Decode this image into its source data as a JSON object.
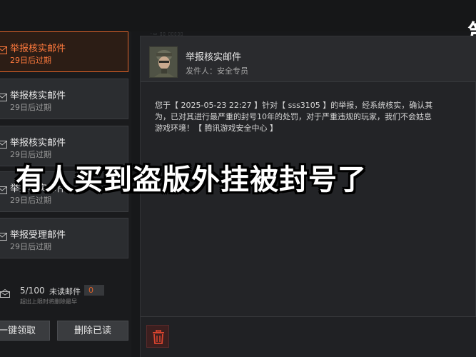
{
  "mail_list": [
    {
      "title": "举报核实邮件",
      "expire": "29日后过期",
      "active": true
    },
    {
      "title": "举报核实邮件",
      "expire": "29日后过期",
      "active": false
    },
    {
      "title": "举报核实邮件",
      "expire": "29日后过期",
      "active": false
    },
    {
      "title": "举报核实邮件",
      "expire": "29日后过期",
      "active": false
    },
    {
      "title": "举报受理邮件",
      "expire": "29日后过期",
      "active": false
    }
  ],
  "mailbox": {
    "count": "5/100",
    "unread_label": "未读邮件",
    "unread_count": "0",
    "limit_note": "超出上限时将删除最早"
  },
  "buttons": {
    "claim": "一键领取",
    "delete_read": "删除已读"
  },
  "detail": {
    "title": "举报核实邮件",
    "sender": "发件人：安全专员",
    "body_lines": [
      "您于【 2025-05-23 22:27 】针对【 sss3105 】的举报，经系统核实，确认其",
      "为，已对其进行最严重的封号10年的处罚，对于严重违规的玩家，我们不会姑息",
      "游戏环境！【 腾讯游戏安全中心 】"
    ]
  },
  "caption": "有人买到盗版外挂被封号了",
  "edge_glyph": "第",
  "colors": {
    "accent": "#e0632a",
    "active_text": "#ff7a3d",
    "panel": "#2b2d30",
    "background": "#17181a"
  },
  "icons": {
    "mail": "envelope-icon",
    "inbox": "inbox-icon",
    "delete": "trash-icon"
  }
}
